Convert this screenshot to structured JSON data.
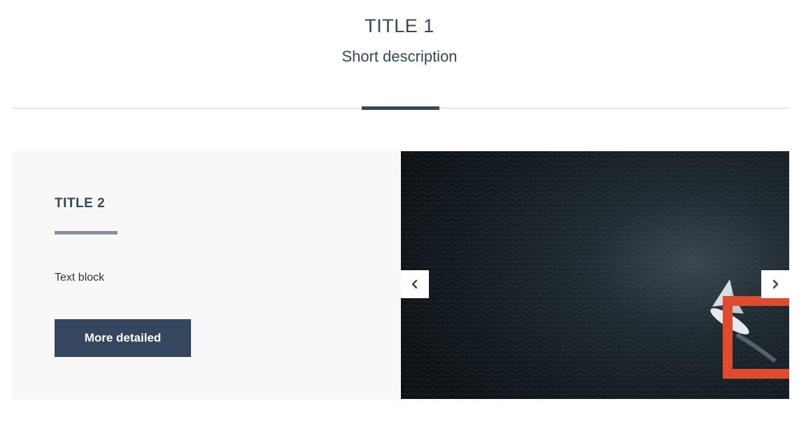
{
  "header": {
    "title": "TITLE 1",
    "description": "Short description"
  },
  "card": {
    "title": "TITLE 2",
    "text": "Text block",
    "button_label": "More detailed"
  },
  "slider": {
    "image_subject": "aerial view of sailboat on dark sea",
    "prev_icon": "chevron-left-icon",
    "next_icon": "chevron-right-icon"
  },
  "colors": {
    "primary": "#34475e",
    "accent_line": "#8792a0",
    "card_bg": "#f8f8f8",
    "frame_accent": "#e04a2f",
    "divider": "#d6d6d6"
  }
}
